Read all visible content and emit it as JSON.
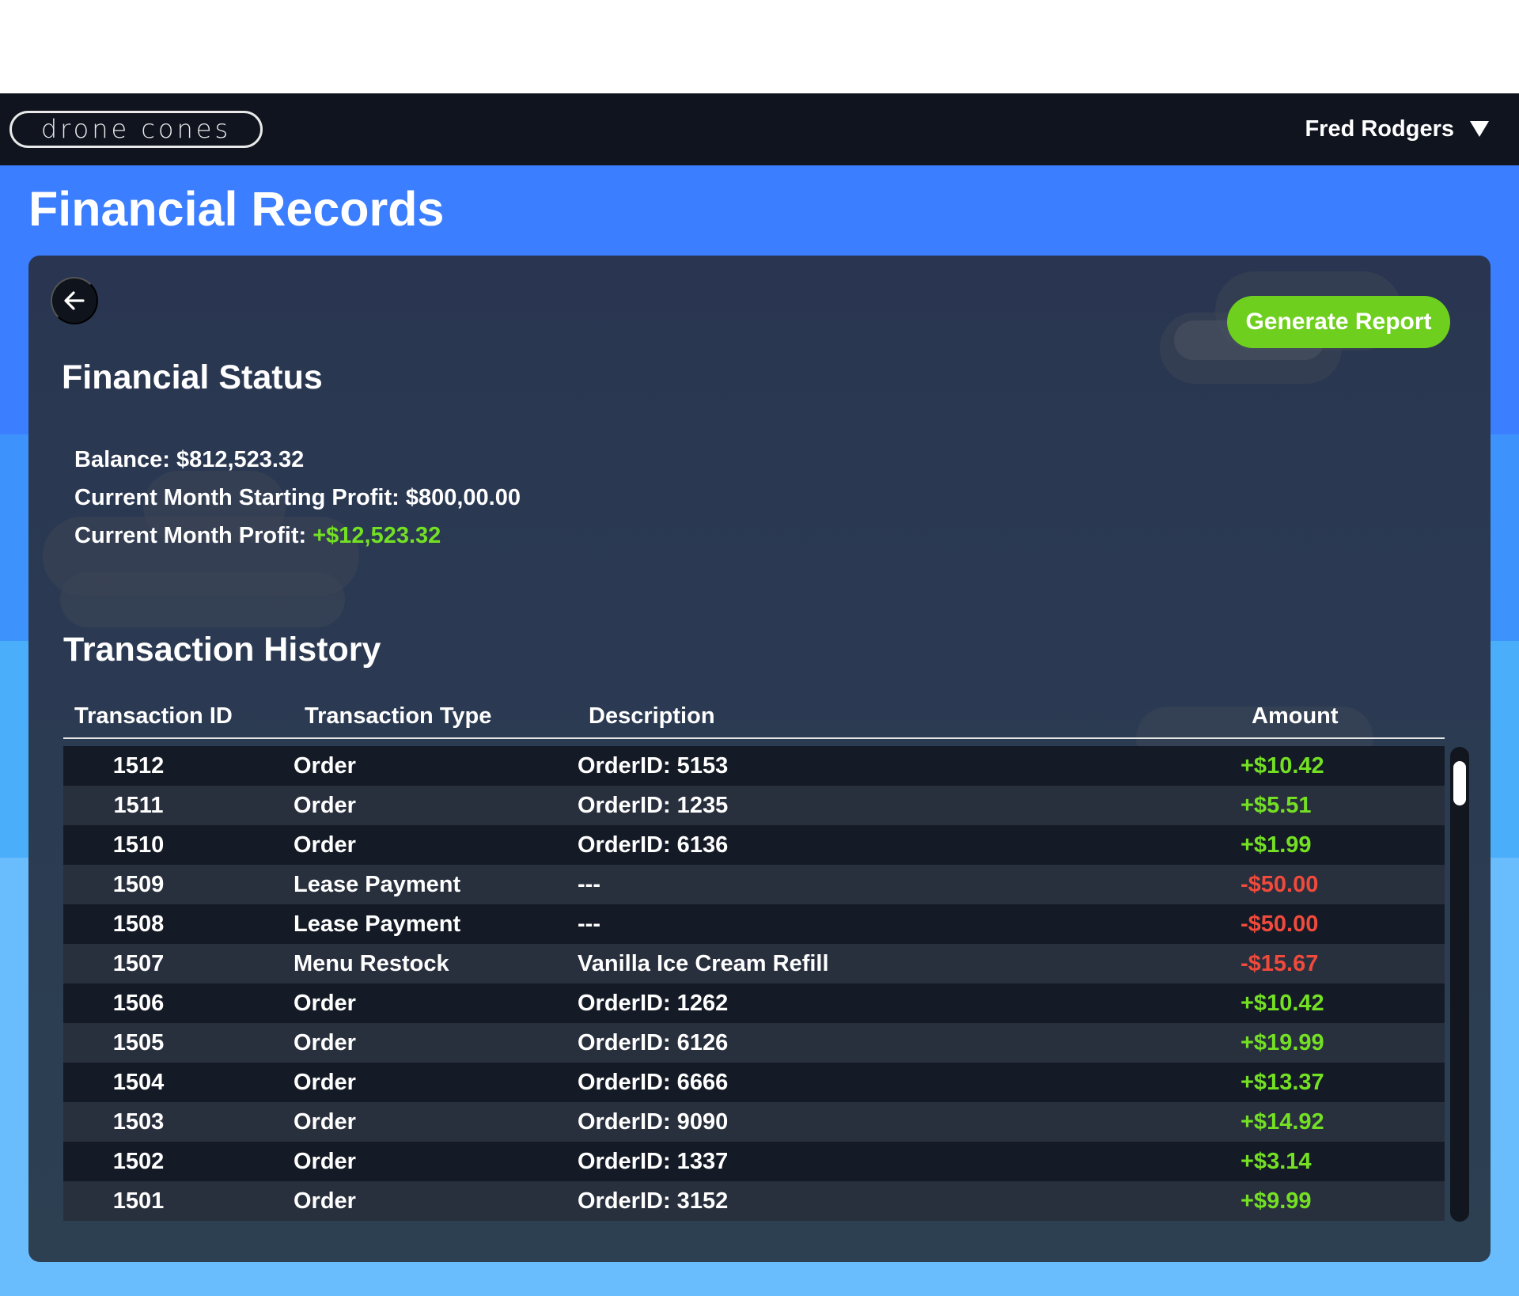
{
  "header": {
    "logo_text": "drone cones",
    "user_name": "Fred Rodgers"
  },
  "page": {
    "title": "Financial Records"
  },
  "actions": {
    "generate_report": "Generate Report"
  },
  "financial_status": {
    "title": "Financial Status",
    "balance_label": "Balance: $812,523.32",
    "starting_profit_label": "Current Month Starting Profit: $800,00.00",
    "month_profit_label": "Current Month Profit:",
    "month_profit_value": "+$12,523.32"
  },
  "transactions": {
    "title": "Transaction History",
    "columns": [
      "Transaction ID",
      "Transaction Type",
      "Description",
      "Amount"
    ],
    "rows": [
      {
        "id": "1512",
        "type": "Order",
        "desc": "OrderID: 5153",
        "amount": "+$10.42",
        "sign": "pos"
      },
      {
        "id": "1511",
        "type": "Order",
        "desc": "OrderID: 1235",
        "amount": "+$5.51",
        "sign": "pos"
      },
      {
        "id": "1510",
        "type": "Order",
        "desc": "OrderID: 6136",
        "amount": "+$1.99",
        "sign": "pos"
      },
      {
        "id": "1509",
        "type": "Lease Payment",
        "desc": "---",
        "amount": "-$50.00",
        "sign": "neg"
      },
      {
        "id": "1508",
        "type": "Lease Payment",
        "desc": "---",
        "amount": "-$50.00",
        "sign": "neg"
      },
      {
        "id": "1507",
        "type": "Menu Restock",
        "desc": "Vanilla Ice Cream Refill",
        "amount": "-$15.67",
        "sign": "neg"
      },
      {
        "id": "1506",
        "type": "Order",
        "desc": "OrderID: 1262",
        "amount": "+$10.42",
        "sign": "pos"
      },
      {
        "id": "1505",
        "type": "Order",
        "desc": "OrderID: 6126",
        "amount": "+$19.99",
        "sign": "pos"
      },
      {
        "id": "1504",
        "type": "Order",
        "desc": "OrderID: 6666",
        "amount": "+$13.37",
        "sign": "pos"
      },
      {
        "id": "1503",
        "type": "Order",
        "desc": "OrderID: 9090",
        "amount": "+$14.92",
        "sign": "pos"
      },
      {
        "id": "1502",
        "type": "Order",
        "desc": "OrderID: 1337",
        "amount": "+$3.14",
        "sign": "pos"
      },
      {
        "id": "1501",
        "type": "Order",
        "desc": "OrderID: 3152",
        "amount": "+$9.99",
        "sign": "pos"
      }
    ]
  },
  "colors": {
    "positive": "#74e024",
    "negative": "#f04a3c",
    "accent_button": "#6fcf1f",
    "header_bg": "#10141f"
  },
  "icons": {
    "back": "arrow-left-icon",
    "user_menu": "caret-down-icon"
  }
}
